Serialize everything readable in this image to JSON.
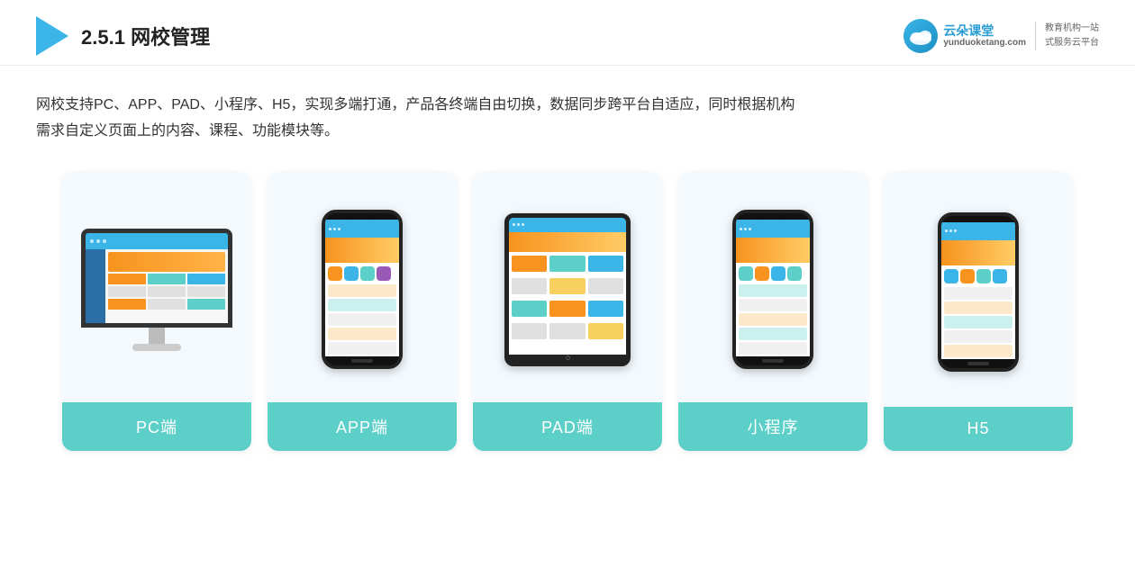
{
  "header": {
    "section": "2.5.1",
    "title_bold": "网校管理",
    "logo_url": "yunduoketang.com",
    "brand_name": "云朵课堂",
    "brand_sub": "yunduoketang.com",
    "slogan_line1": "教育机构一站",
    "slogan_line2": "式服务云平台"
  },
  "description": {
    "line1": "网校支持PC、APP、PAD、小程序、H5，实现多端打通，产品各终端自由切换，数据同步跨平台自适应，同时根据机构",
    "line2": "需求自定义页面上的内容、课程、功能模块等。"
  },
  "cards": [
    {
      "id": "pc",
      "label": "PC端"
    },
    {
      "id": "app",
      "label": "APP端"
    },
    {
      "id": "pad",
      "label": "PAD端"
    },
    {
      "id": "miniapp",
      "label": "小程序"
    },
    {
      "id": "h5",
      "label": "H5"
    }
  ],
  "accent_color": "#5ccfc8",
  "header_color": "#3bb5e8"
}
